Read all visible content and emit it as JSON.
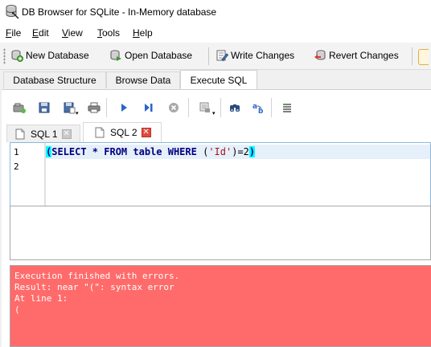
{
  "window": {
    "title": "DB Browser for SQLite - In-Memory database"
  },
  "menu": [
    {
      "accel": "F",
      "rest": "ile"
    },
    {
      "accel": "E",
      "rest": "dit"
    },
    {
      "accel": "V",
      "rest": "iew"
    },
    {
      "accel": "T",
      "rest": "ools"
    },
    {
      "accel": "H",
      "rest": "elp"
    }
  ],
  "toolbar": {
    "new_database": "New Database",
    "open_database": "Open Database",
    "write_changes": "Write Changes",
    "revert_changes": "Revert Changes"
  },
  "tabs": [
    "Database Structure",
    "Browse Data",
    "Execute SQL"
  ],
  "sql_tabs": [
    "SQL 1",
    "SQL 2"
  ],
  "editor": {
    "line_numbers": [
      "1",
      "2"
    ],
    "code": {
      "open_paren": "(",
      "kw1": "SELECT * FROM table WHERE ",
      "open2": "(",
      "string": "'Id'",
      "rest": ")=2",
      "close_paren": ")"
    }
  },
  "error": {
    "lines": [
      "Execution finished with errors.",
      "Result: near \"(\": syntax error",
      "At line 1:",
      "("
    ]
  },
  "colors": {
    "error_bg": "#ff6b6b",
    "match_brace": "#00ffff",
    "keyword": "#000080"
  }
}
